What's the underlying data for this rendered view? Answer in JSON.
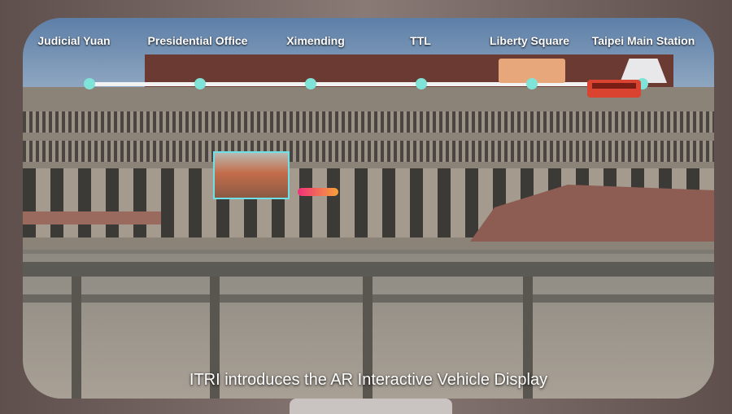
{
  "route": {
    "stops": [
      {
        "label": "Judicial Yuan"
      },
      {
        "label": "Presidential Office"
      },
      {
        "label": "Ximending"
      },
      {
        "label": "TTL"
      },
      {
        "label": "Liberty Square"
      },
      {
        "label": "Taipei Main Station"
      }
    ],
    "current_position_icon": "bus-icon",
    "colors": {
      "stop_dot": "#7fe3d8",
      "bus": "#d9432f",
      "poi_border": "#6fe0e8"
    }
  },
  "caption": "ITRI introduces the AR Interactive Vehicle Display"
}
